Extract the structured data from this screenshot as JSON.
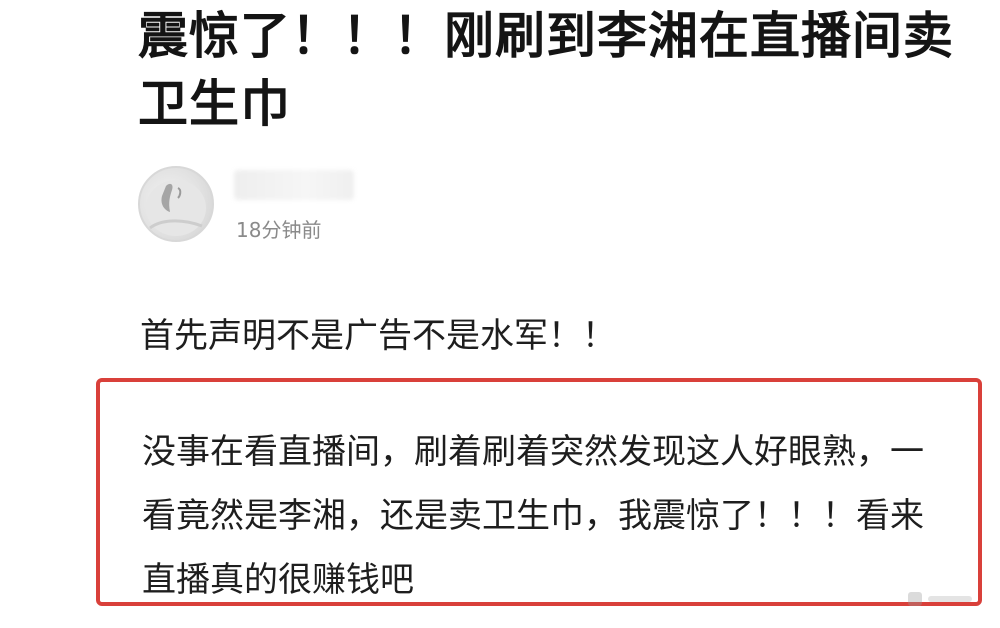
{
  "post": {
    "title": "震惊了！！！刚刷到李湘在直播间卖卫生巾",
    "author": {
      "time_ago": "18分钟前"
    },
    "disclaimer": "首先声明不是广告不是水军！！",
    "body": "没事在看直播间，刷着刷着突然发现这人好眼熟，一看竟然是李湘，还是卖卫生巾，我震惊了！！！看来直播真的很赚钱吧"
  },
  "colors": {
    "highlight_border": "#d9403a",
    "title_text": "#141414",
    "meta_text": "#8a8a8a"
  },
  "icons": {
    "avatar": "user-avatar-photo",
    "name_redaction": "blurred-username"
  }
}
